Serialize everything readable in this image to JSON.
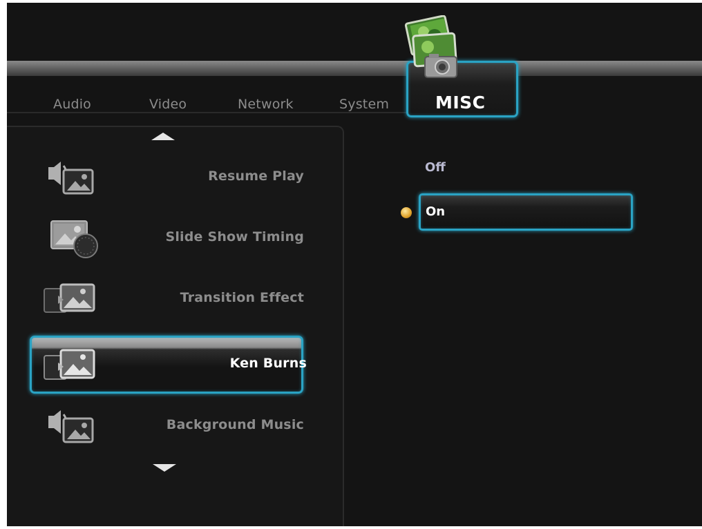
{
  "tabs": [
    {
      "label": "Audio"
    },
    {
      "label": "Video"
    },
    {
      "label": "Network"
    },
    {
      "label": "System"
    },
    {
      "label": "MISC"
    }
  ],
  "active_tab": "MISC",
  "active_tab_icon": "photo-camera-icon",
  "menu": {
    "items": [
      {
        "label": "Resume Play",
        "icon": "speaker-photo-icon"
      },
      {
        "label": "Slide Show Timing",
        "icon": "photo-clock-icon"
      },
      {
        "label": "Transition Effect",
        "icon": "photo-transition-icon"
      },
      {
        "label": "Ken Burns",
        "icon": "photo-transition-icon",
        "selected": true
      },
      {
        "label": "Background Music",
        "icon": "speaker-photo-icon"
      }
    ]
  },
  "options": {
    "items": [
      {
        "label": "Off"
      },
      {
        "label": "On",
        "selected": true
      }
    ]
  },
  "colors": {
    "accent": "#2aa3c4",
    "background": "#141414",
    "selected_dot": "#e0a22a"
  }
}
